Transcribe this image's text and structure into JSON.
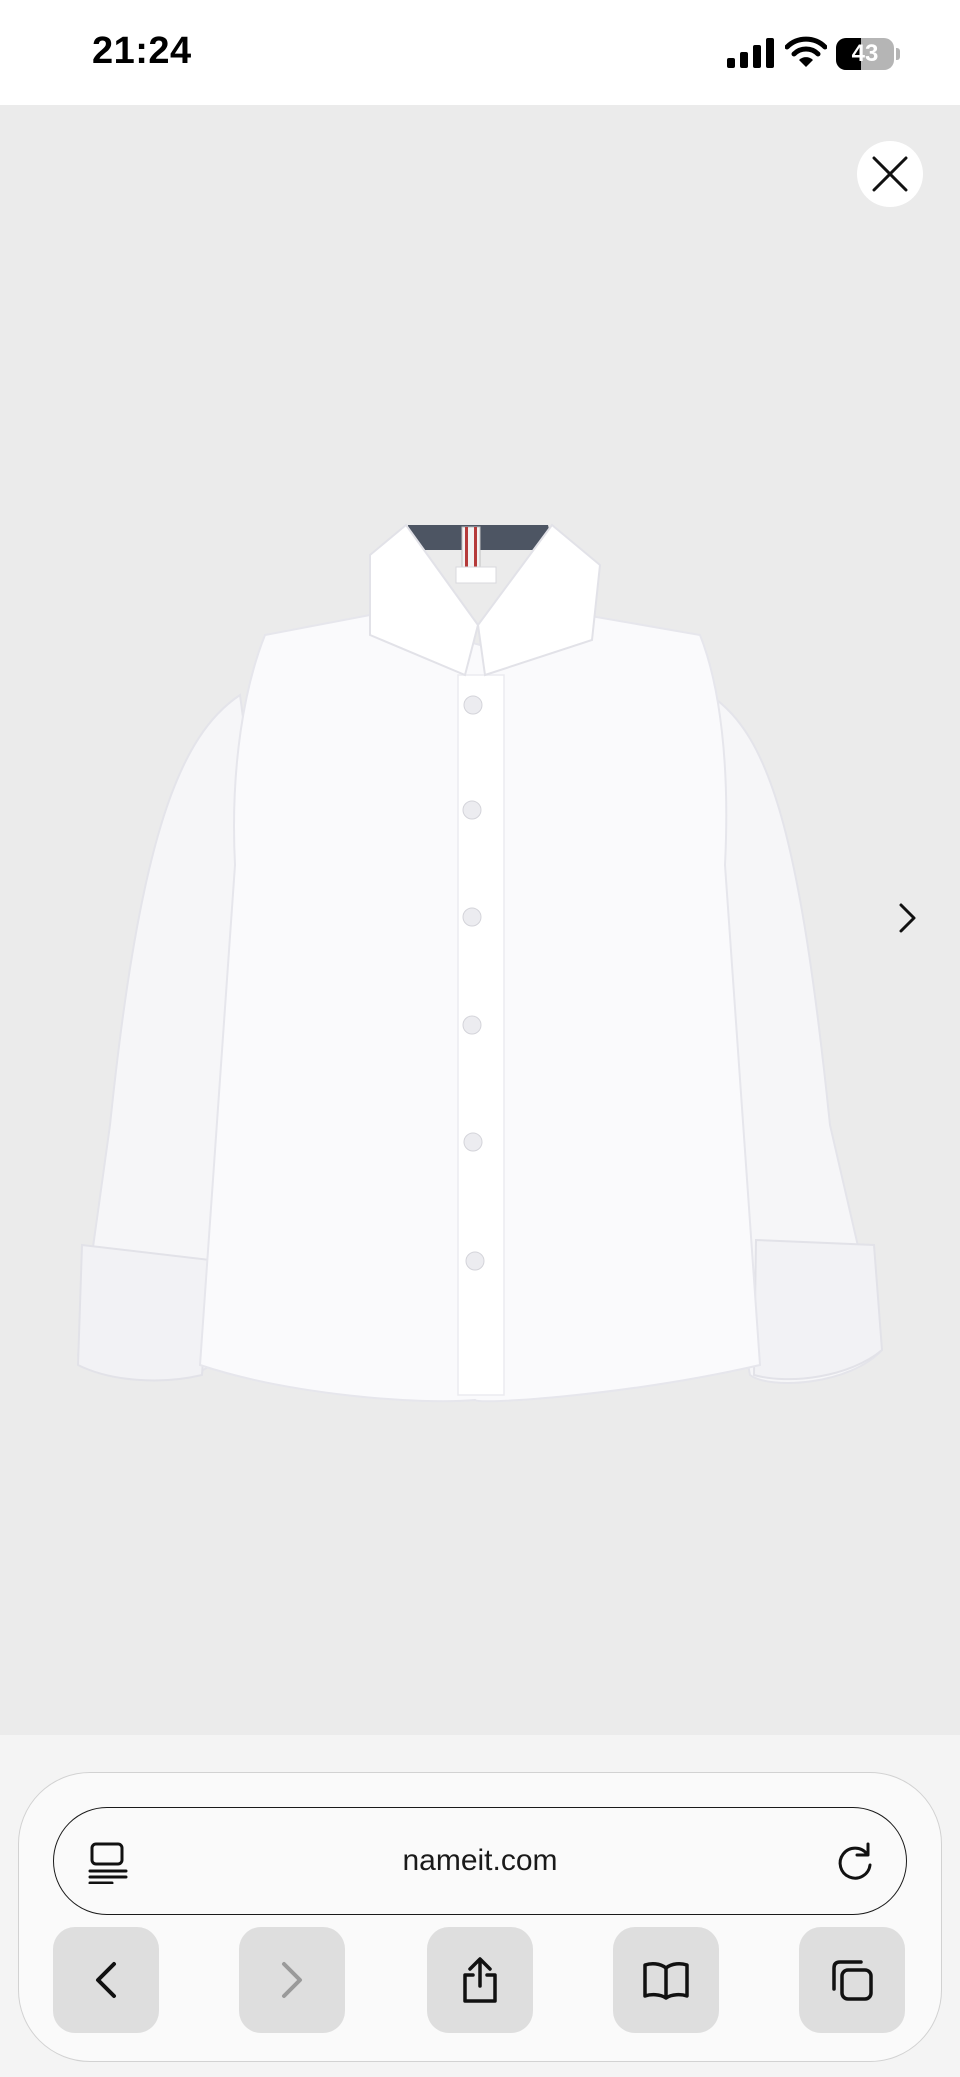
{
  "status_bar": {
    "time": "21:24",
    "battery_level": "43",
    "battery_fraction": 0.43,
    "icons": [
      "cellular-signal-icon",
      "wifi-icon",
      "battery-icon"
    ]
  },
  "gallery": {
    "background_color": "#ebebeb",
    "image_subject": "white long-sleeve button-up shirt",
    "controls": [
      "close-icon",
      "chevron-right-icon"
    ]
  },
  "browser": {
    "url": "nameit.com",
    "address_icons": [
      "reader-icon",
      "reload-icon"
    ],
    "toolbar_buttons": [
      {
        "name": "back-button",
        "icon": "chevron-left-icon",
        "enabled": true
      },
      {
        "name": "forward-button",
        "icon": "chevron-right-icon",
        "enabled": false
      },
      {
        "name": "share-button",
        "icon": "share-icon",
        "enabled": true
      },
      {
        "name": "bookmarks-button",
        "icon": "book-icon",
        "enabled": true
      },
      {
        "name": "tabs-button",
        "icon": "tabs-icon",
        "enabled": true
      }
    ]
  }
}
